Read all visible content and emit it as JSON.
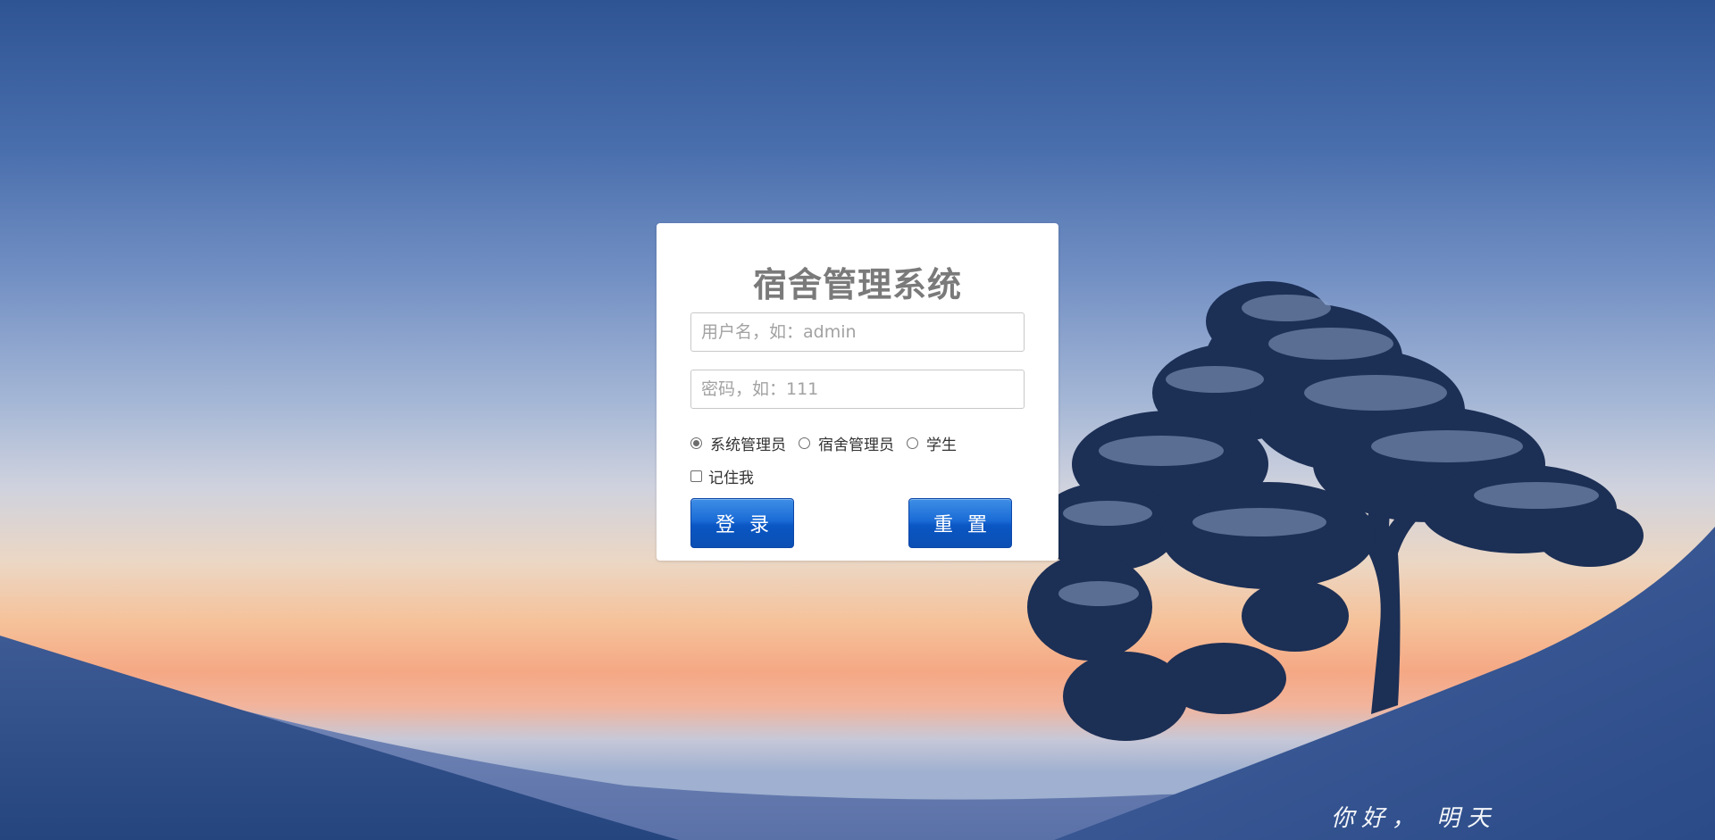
{
  "login": {
    "title": "宿舍管理系统",
    "username_placeholder": "用户名，如：admin",
    "username_value": "",
    "password_placeholder": "密码，如：111",
    "password_value": "",
    "roles": [
      {
        "label": "系统管理员",
        "selected": true
      },
      {
        "label": "宿舍管理员",
        "selected": false
      },
      {
        "label": "学生",
        "selected": false
      }
    ],
    "remember_label": "记住我",
    "remember_checked": false,
    "login_button": "登录",
    "reset_button": "重置"
  },
  "background": {
    "greeting_text": "你好， 明天"
  },
  "colors": {
    "button_blue": "#0a56c4",
    "title_gray": "#7a7a7a"
  }
}
